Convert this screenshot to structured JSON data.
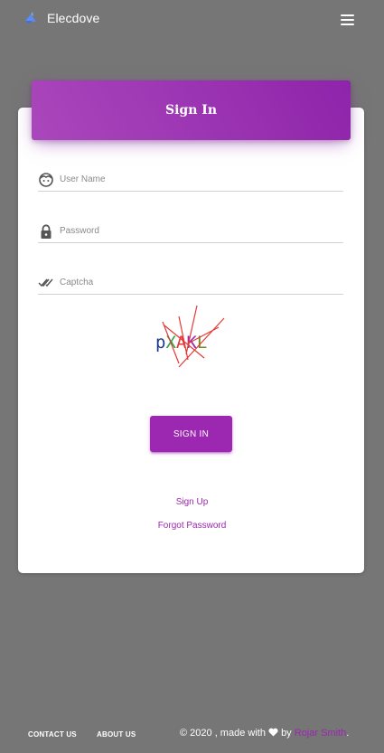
{
  "navbar": {
    "brand": "Elecdove",
    "brand_icon": "bird-logo-icon",
    "menu_icon": "hamburger-menu-icon"
  },
  "card": {
    "title": "Sign In",
    "fields": {
      "username": {
        "placeholder": "User Name",
        "value": "",
        "icon": "face-icon"
      },
      "password": {
        "placeholder": "Password",
        "value": "",
        "icon": "lock-icon"
      },
      "captcha": {
        "placeholder": "Captcha",
        "value": "",
        "icon": "double-check-icon"
      }
    },
    "captcha_text": "pXAKL",
    "submit_label": "SIGN IN",
    "signup_label": "Sign Up",
    "forgot_label": "Forgot Password"
  },
  "footer": {
    "contact_label": "CONTACT US",
    "about_label": "ABOUT US",
    "copyright_prefix": "© 2020 , made with",
    "copyright_by": "by",
    "author": "Rojar Smith",
    "suffix": "."
  },
  "colors": {
    "background": "#767676",
    "accent": "#9c27b0",
    "header_gradient_start": "#ab47bc",
    "header_gradient_end": "#8e24aa",
    "captcha_letter_colors": [
      "#1e3a8a",
      "#22a84a",
      "#e53935",
      "#9c27b0",
      "#6b8e23"
    ]
  }
}
